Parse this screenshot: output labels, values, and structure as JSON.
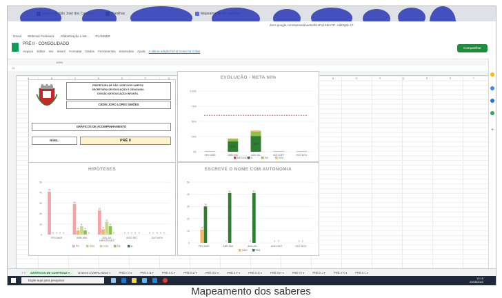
{
  "browser": {
    "tabs": [
      {
        "label": "Cursos de São José dos Campos"
      },
      {
        "label": "Planilhas"
      },
      {
        "label": "Mapeamento dos saberes"
      }
    ],
    "address": "docs.google.com/spreadsheets/d/1vFu1SdmYP...edit#gid=17",
    "bookmarks": [
      "Gmail",
      "Webmail Prefeitura",
      "Alfabetização e letr...",
      "PLANNER"
    ]
  },
  "sheets": {
    "doc_title": "PRÉ II - CONSOLIDADO",
    "menus": [
      "Arquivo",
      "Editar",
      "Ver",
      "Inserir",
      "Formatar",
      "Dados",
      "Ferramentas",
      "Extensões",
      "Ajuda"
    ],
    "last_edit": "A última edição foi há horas há 3 dias",
    "share_label": "Compartilhar",
    "zoom": "100%",
    "cell_ref": "A1",
    "columns": [
      "A",
      "B",
      "C",
      "D",
      "E",
      "F",
      "G",
      "H",
      "I",
      "J",
      "K",
      "L",
      "M",
      "N",
      "O",
      "P",
      "Q",
      "R",
      "S",
      "T"
    ],
    "sheet_tabs": [
      "GRÁFICOS DE CONTROLE",
      "DADOS COMPILADOS",
      "PRÉ II A",
      "PRÉ II B",
      "PRÉ II C",
      "PRÉ II D",
      "PRÉ II E",
      "PRÉ II F",
      "PRÉ II G",
      "PRÉ II H",
      "PRÉ II I",
      "PRÉ II J",
      "PRÉ II K",
      "PRÉ II L"
    ]
  },
  "header_card": {
    "prefeitura_lines": [
      "PREFEITURA DE SÃO JOSÉ DOS CAMPOS",
      "SECRETARIA DE EDUCAÇÃO E CIDADANIA",
      "DIVISÃO DE EDUCAÇÃO INFANTIL"
    ],
    "school": "CEDIN JOÃO LOPES SIMÕES",
    "section_title": "GRÁFICOS DE ACOMPANHAMENTO",
    "nivel_label": "NÍVEL:",
    "nivel_value": "PRÉ II"
  },
  "taskbar": {
    "search_placeholder": "Digite aqui para pesquisar",
    "time": "12:18",
    "date": "20/08/2022"
  },
  "caption": "Mapeamento dos saberes",
  "colors": {
    "ps": "#f4a3a6",
    "ssv": "#f5b562",
    "csv": "#c6d98e",
    "sa": "#8bc34a",
    "a": "#2e7d32",
    "meta": "#e53935"
  },
  "chart_data": [
    {
      "type": "bar",
      "title": "EVOLUÇÃO - META 60%",
      "categories": [
        "FEV-MAR",
        "ABR-MAI",
        "JUN-JUL",
        "AGO-SET",
        "OUT-NOV"
      ],
      "yticks": [
        "0%",
        "25%",
        "50%",
        "75%",
        "100%"
      ],
      "ylim": [
        0,
        100
      ],
      "meta": 60,
      "legend": [
        "META 60%",
        "A",
        "SA",
        "SSV"
      ],
      "series": [
        {
          "name": "A",
          "values": [
            0,
            17,
            26,
            0,
            0
          ]
        },
        {
          "name": "SA",
          "values": [
            0,
            4,
            7,
            0,
            0
          ]
        },
        {
          "name": "SSV",
          "values": [
            0,
            1,
            2,
            0,
            0
          ]
        }
      ],
      "labels": [
        {
          "category": "ABR-MAI",
          "text": "17%"
        },
        {
          "category": "JUN-JUL",
          "text": "26%"
        }
      ]
    },
    {
      "type": "bar",
      "title": "HIPÓTESES",
      "xlabel": "HIPÓTESES",
      "categories": [
        "FEV-MAR",
        "ABR-MAI",
        "JUN-JUL",
        "AGO-SET",
        "OUT-NOV"
      ],
      "ylim": [
        0,
        50
      ],
      "yticks": [
        "0",
        "10",
        "20",
        "30",
        "40",
        "50"
      ],
      "legend": [
        "PS",
        "SSV",
        "CSV",
        "SA",
        "A"
      ],
      "series": [
        {
          "name": "PS",
          "values": [
            41,
            29,
            23,
            0,
            0
          ]
        },
        {
          "name": "SSV",
          "values": [
            0,
            4,
            5,
            0,
            0
          ]
        },
        {
          "name": "CSV",
          "values": [
            0,
            8,
            12,
            0,
            0
          ]
        },
        {
          "name": "SA",
          "values": [
            0,
            4,
            8,
            0,
            0
          ]
        },
        {
          "name": "A",
          "values": [
            0,
            0,
            0,
            0,
            0
          ]
        }
      ]
    },
    {
      "type": "bar",
      "title": "ESCREVE O NOME COM AUTONOMIA",
      "categories": [
        "FEV-MAR",
        "ABR-MAI",
        "JUN-JUL",
        "AGO-SET",
        "OUT-NOV"
      ],
      "ylim": [
        0,
        50
      ],
      "yticks": [
        "0",
        "10",
        "20",
        "30",
        "40",
        "50"
      ],
      "legend": [
        "NÃO",
        "SIM"
      ],
      "series": [
        {
          "name": "NÃO",
          "values": [
            11,
            0,
            0,
            0,
            0
          ]
        },
        {
          "name": "SIM",
          "values": [
            30,
            41,
            41,
            0,
            0
          ]
        }
      ]
    }
  ]
}
